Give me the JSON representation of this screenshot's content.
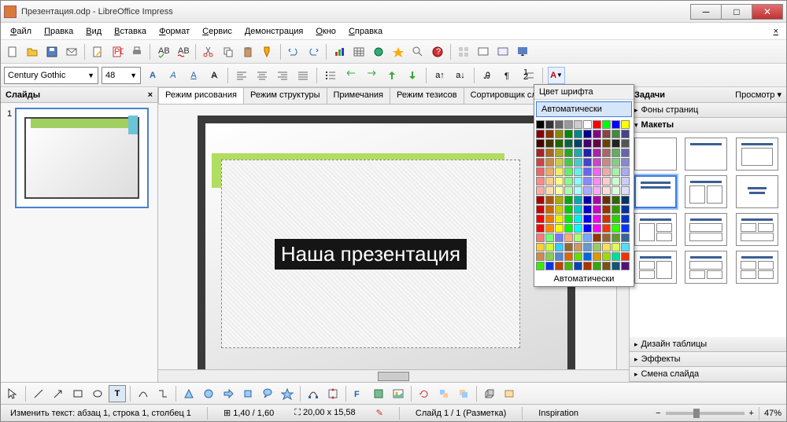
{
  "title": "Презентация.odp - LibreOffice Impress",
  "menu": [
    "Файл",
    "Правка",
    "Вид",
    "Вставка",
    "Формат",
    "Сервис",
    "Демонстрация",
    "Окно",
    "Справка"
  ],
  "format": {
    "font": "Century Gothic",
    "size": "48"
  },
  "slidepanel": {
    "title": "Слайды",
    "num": "1"
  },
  "tabs": [
    "Режим рисования",
    "Режим структуры",
    "Примечания",
    "Режим тезисов",
    "Сортировщик слайдов"
  ],
  "slide_text": "Наша презентация",
  "colordrop": {
    "title": "Цвет шрифта",
    "auto": "Автоматически",
    "autobottom": "Автоматически"
  },
  "colors": [
    "#000",
    "#333",
    "#666",
    "#999",
    "#ccc",
    "#fff",
    "#f00",
    "#0f0",
    "#00f",
    "#ff0",
    "#800",
    "#830",
    "#880",
    "#080",
    "#088",
    "#008",
    "#808",
    "#844",
    "#484",
    "#448",
    "#400",
    "#430",
    "#260",
    "#064",
    "#046",
    "#406",
    "#604",
    "#640",
    "#222",
    "#555",
    "#a22",
    "#a62",
    "#aa2",
    "#2a2",
    "#2aa",
    "#22a",
    "#a2a",
    "#a66",
    "#6a6",
    "#66a",
    "#c44",
    "#c84",
    "#cc4",
    "#4c4",
    "#4cc",
    "#44c",
    "#c4c",
    "#c88",
    "#8c8",
    "#88c",
    "#e66",
    "#ea6",
    "#ee6",
    "#6e6",
    "#6ee",
    "#66e",
    "#e6e",
    "#eaa",
    "#aea",
    "#aae",
    "#f88",
    "#fc8",
    "#ff8",
    "#8f8",
    "#8ff",
    "#88f",
    "#f8f",
    "#fcc",
    "#cfc",
    "#ccf",
    "#faa",
    "#fda",
    "#ffa",
    "#afa",
    "#aff",
    "#aaf",
    "#faf",
    "#fdd",
    "#dfd",
    "#ddf",
    "#a00",
    "#a50",
    "#aa0",
    "#0a0",
    "#0aa",
    "#00a",
    "#a0a",
    "#630",
    "#360",
    "#036",
    "#c00",
    "#c60",
    "#cc0",
    "#0c0",
    "#0cc",
    "#00c",
    "#c0c",
    "#930",
    "#390",
    "#039",
    "#e00",
    "#e70",
    "#ee0",
    "#0e0",
    "#0ee",
    "#00e",
    "#e0e",
    "#c30",
    "#3c0",
    "#03c",
    "#f00",
    "#f80",
    "#ff0",
    "#0f0",
    "#0ff",
    "#00f",
    "#f0f",
    "#f30",
    "#3f0",
    "#03f",
    "#f77",
    "#7f7",
    "#77f",
    "#fa7",
    "#af7",
    "#7af",
    "#930",
    "#963",
    "#693",
    "#369",
    "#fc3",
    "#cf3",
    "#3cf",
    "#963",
    "#c96",
    "#69c",
    "#9c6",
    "#fd5",
    "#df5",
    "#5df",
    "#c85",
    "#8c5",
    "#58c",
    "#d60",
    "#6d0",
    "#06d",
    "#d90",
    "#9d0",
    "#0d9",
    "#e30",
    "#3e0",
    "#03e",
    "#b40",
    "#4b0",
    "#04b",
    "#a30",
    "#3a0",
    "#751",
    "#157",
    "#517",
    "#175",
    "#147",
    "#714",
    "#471",
    "#841",
    "#184",
    "#418",
    "#a52",
    "#2a5",
    "#52a",
    "#a26",
    "#6a2",
    "#26a",
    "#7b3",
    "#37b",
    "#b37",
    "#b73"
  ],
  "taskpanel": {
    "title": "Задачи",
    "view": "Просмотр",
    "sections": {
      "bg": "Фоны страниц",
      "layouts": "Макеты",
      "table": "Дизайн таблицы",
      "effects": "Эффекты",
      "transition": "Смена слайда"
    }
  },
  "status": {
    "mode": "Изменить текст: абзац 1, строка 1, столбец 1",
    "scale": "1,40 / 1,60",
    "pos": "20,00 x 15,58",
    "slide": "Слайд 1 / 1 (Разметка)",
    "template": "Inspiration",
    "zoom": "47%"
  }
}
